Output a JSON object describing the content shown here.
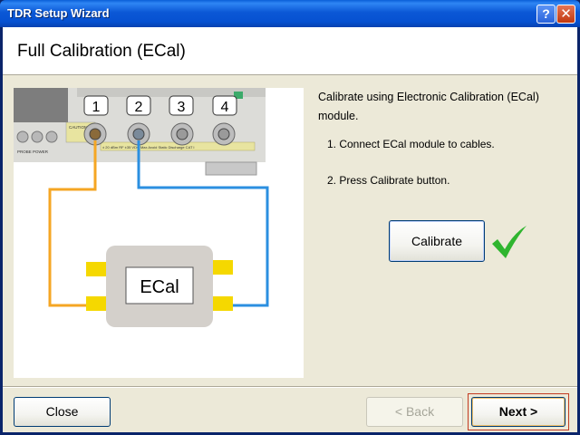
{
  "window": {
    "title": "TDR Setup Wizard",
    "help_glyph": "?",
    "close_glyph": "✕"
  },
  "header": {
    "title": "Full Calibration (ECal)"
  },
  "illustration": {
    "port_labels": [
      "1",
      "2",
      "3",
      "4"
    ],
    "module_label": "ECal",
    "panel_text_left": "PROBE POWER",
    "panel_text_warning": "CAUTION",
    "panel_text_strip": "± 20 dBm RF ±35 VDC Max   Avoid Static Discharge CAT I",
    "cable_colors": {
      "port1": "#f5a623",
      "port2": "#2b8fe0"
    }
  },
  "instructions": {
    "intro": "Calibrate using Electronic Calibration (ECal) module.",
    "step1": "1. Connect ECal module to cables.",
    "step2": "2. Press Calibrate button."
  },
  "buttons": {
    "calibrate": "Calibrate",
    "close": "Close",
    "back": "< Back",
    "next": "Next >"
  },
  "status": {
    "calibrated_icon": "checkmark-icon",
    "check_color": "#2fb52f"
  }
}
